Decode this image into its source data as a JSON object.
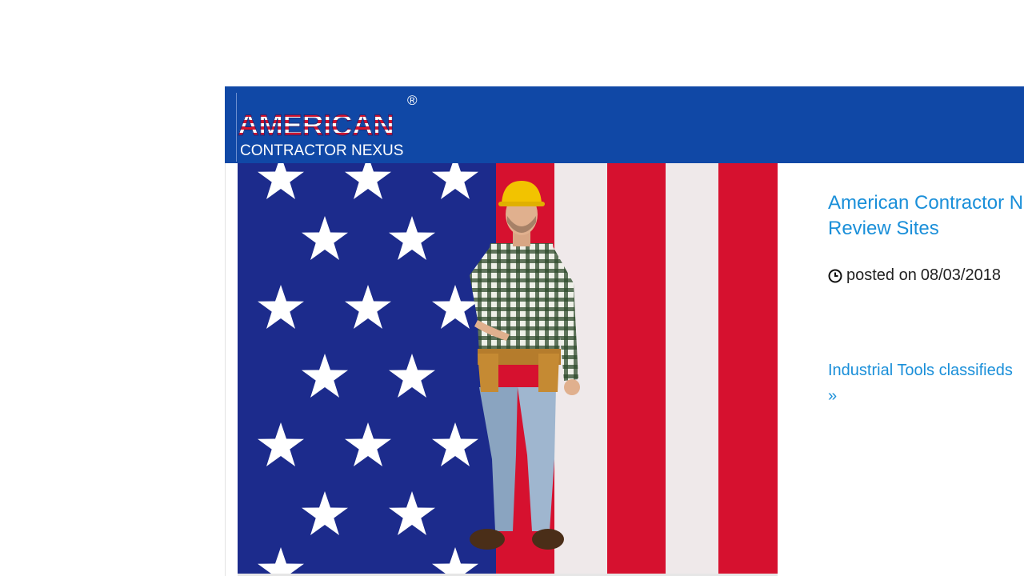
{
  "header": {
    "logo_title": "AMERICAN",
    "logo_subtitle": "CONTRACTOR NEXUS",
    "logo_registered": "®",
    "background": "#1048a6"
  },
  "post": {
    "title_line1": "American Contractor N",
    "title_line2": "Review Sites",
    "posted_prefix": "posted on",
    "posted_date": "08/03/2018",
    "category_link": "Industrial Tools classifieds",
    "more_link": "»"
  },
  "colors": {
    "link": "#1a8fd9",
    "flag_blue": "#1c2b8c",
    "flag_red": "#d6112f",
    "flag_white": "#efe9ea"
  },
  "icons": {
    "clock": "clock-icon",
    "worker": "construction-worker-image"
  }
}
